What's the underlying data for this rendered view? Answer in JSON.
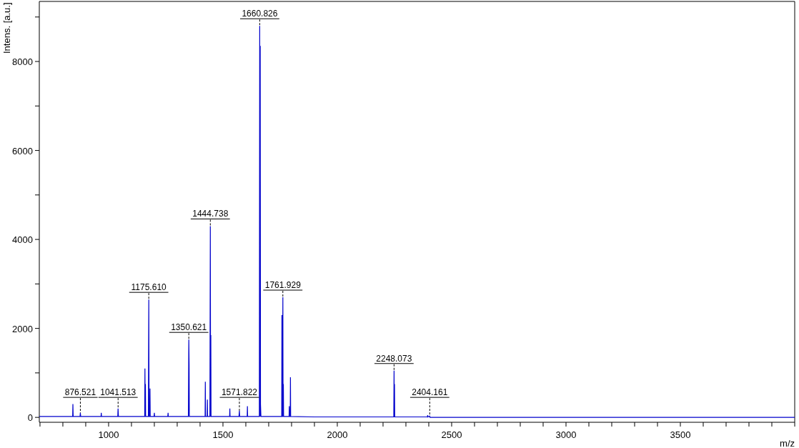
{
  "chart_data": {
    "type": "line",
    "xlabel": "m/z",
    "ylabel": "Intens. [a.u.]",
    "xlim": [
      697,
      4000
    ],
    "ylim": [
      -110,
      9350
    ],
    "xticks": [
      1000,
      1500,
      2000,
      2500,
      3000,
      3500
    ],
    "yticks": [
      0,
      2000,
      4000,
      6000,
      8000
    ],
    "x": [
      697,
      843,
      844,
      845,
      875,
      876.521,
      878,
      967,
      968,
      969,
      1040,
      1041.513,
      1043,
      1158,
      1159,
      1160,
      1161,
      1162,
      1174,
      1175.61,
      1177,
      1180,
      1181,
      1182,
      1199,
      1200,
      1201,
      1259,
      1260,
      1261,
      1349,
      1350.621,
      1352,
      1353,
      1422,
      1423,
      1424,
      1431,
      1432,
      1433,
      1443,
      1444.738,
      1446,
      1447,
      1448,
      1529,
      1530,
      1531,
      1570,
      1571.822,
      1573,
      1606,
      1607,
      1608,
      1659,
      1660.826,
      1662,
      1663,
      1664,
      1666,
      1757,
      1758,
      1759,
      1760,
      1761.929,
      1763,
      1764,
      1765,
      1789,
      1790,
      1791,
      1794,
      1795,
      1796,
      1900,
      2247,
      2248.073,
      2249,
      2250,
      2251,
      2394,
      2395,
      2396,
      2404.161,
      2405,
      4000
    ],
    "series": [
      {
        "color": "#0000cc",
        "values": [
          20,
          20,
          300,
          20,
          20,
          100,
          20,
          20,
          100,
          20,
          20,
          200,
          20,
          20,
          1100,
          20,
          750,
          20,
          20,
          2650,
          20,
          20,
          650,
          20,
          20,
          100,
          20,
          20,
          100,
          20,
          20,
          1750,
          1200,
          20,
          20,
          800,
          20,
          20,
          400,
          20,
          20,
          4300,
          20,
          1850,
          20,
          20,
          200,
          20,
          20,
          150,
          20,
          20,
          250,
          20,
          20,
          8800,
          20,
          8350,
          300,
          20,
          20,
          2300,
          20,
          20,
          2700,
          20,
          750,
          20,
          20,
          250,
          20,
          20,
          900,
          20,
          10,
          10,
          1050,
          10,
          750,
          10,
          10,
          50,
          10,
          30,
          0,
          0
        ]
      }
    ],
    "annotations": [
      "876.521",
      "1041.513",
      "1175.610",
      "1350.621",
      "1444.738",
      "1571.822",
      "1660.826",
      "1761.929",
      "2248.073",
      "2404.161"
    ]
  }
}
